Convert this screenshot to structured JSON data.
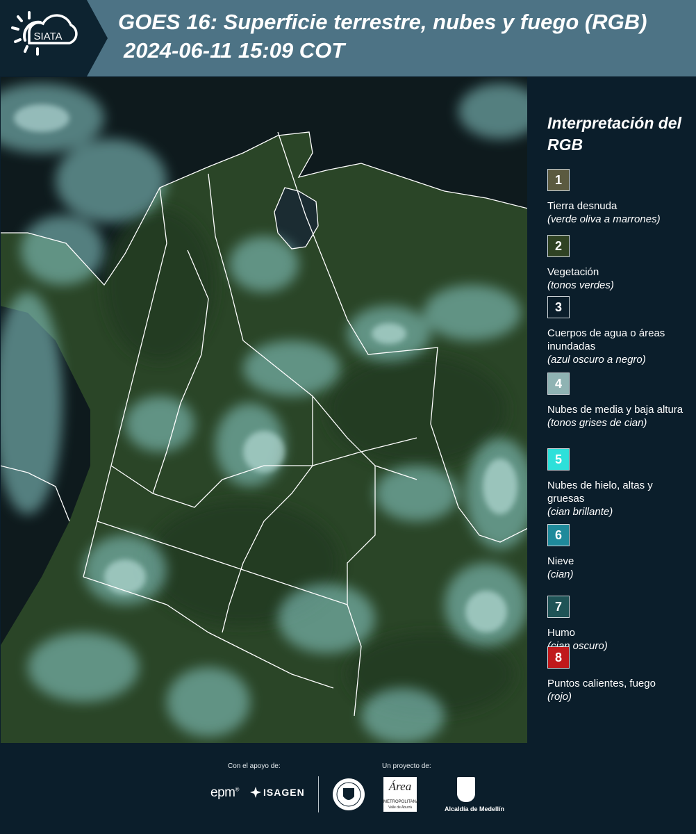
{
  "header": {
    "logo_text": "SIATA",
    "title": "GOES 16: Superficie terrestre, nubes y fuego (RGB)",
    "subtitle": "2024-06-11 15:09 COT",
    "background_color": "#4d7385",
    "logo_block_color": "#0d2330"
  },
  "map": {
    "description_icon": "satellite-rgb-map",
    "colors": {
      "ocean": "#0e1a1d",
      "land": "#2a4527",
      "cloud": "#8ed3d0",
      "border": "#ffffff"
    }
  },
  "legend": {
    "title": "Interpretación del RGB",
    "items": [
      {
        "number": "1",
        "label": "Tierra desnuda",
        "desc": "(verde oliva a marrones)",
        "color": "#5b5a40"
      },
      {
        "number": "2",
        "label": "Vegetación",
        "desc": "(tonos verdes)",
        "color": "#2f4223"
      },
      {
        "number": "3",
        "label": "Cuerpos de agua o áreas inundadas",
        "desc": "(azul oscuro a negro)",
        "color": "#0b1e2b"
      },
      {
        "number": "4",
        "label": "Nubes de media y baja altura",
        "desc": "(tonos grises de cian)",
        "color": "#8fb3b3"
      },
      {
        "number": "5",
        "label": "Nubes de hielo, altas y gruesas",
        "desc": "(cian brillante)",
        "color": "#2de0da"
      },
      {
        "number": "6",
        "label": "Nieve",
        "desc": "(cian)",
        "color": "#1f8a9b"
      },
      {
        "number": "7",
        "label": "Humo",
        "desc": "(cian oscuro)",
        "color": "#1f5356"
      },
      {
        "number": "8",
        "label": "Puntos calientes, fuego",
        "desc": "(rojo)",
        "color": "#c0191c"
      }
    ]
  },
  "footer": {
    "support_caption": "Con el apoyo de:",
    "project_caption": "Un proyecto de:",
    "epm_logo": "epm",
    "epm_reg": "®",
    "isagen_logo": "ISAGEN",
    "area_logo": "Área",
    "area_sub1": "METROPOLITANA",
    "area_sub2": "Valle de Aburrá",
    "alcaldia_logo": "Alcaldía de Medellín"
  }
}
